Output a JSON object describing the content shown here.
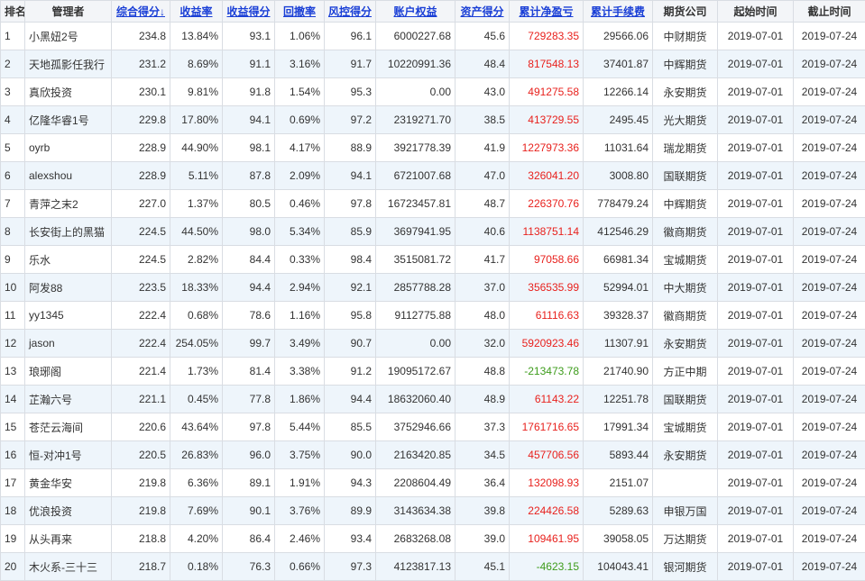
{
  "colors": {
    "positive": "#e8211d",
    "negative": "#3e9c1c",
    "sort_link": "#1a3fd6"
  },
  "headers": {
    "rank": "排名",
    "manager": "管理者",
    "total_score": "综合得分↓",
    "return_rate": "收益率",
    "return_score": "收益得分",
    "drawdown": "回撤率",
    "risk_score": "风控得分",
    "equity": "账户权益",
    "asset_score": "资产得分",
    "net_pnl": "累计净盈亏",
    "fees": "累计手续费",
    "broker": "期货公司",
    "start": "起始时间",
    "end": "截止时间"
  },
  "rows": [
    {
      "rank": "1",
      "manager": "小黑妞2号",
      "total": "234.8",
      "rate": "13.84%",
      "rscore": "93.1",
      "dd": "1.06%",
      "risk": "96.1",
      "equity": "6000227.68",
      "asset": "45.6",
      "pnl": "729283.35",
      "sign": "pos",
      "fees": "29566.06",
      "broker": "中财期货",
      "start": "2019-07-01",
      "end": "2019-07-24"
    },
    {
      "rank": "2",
      "manager": "天地孤影任我行",
      "total": "231.2",
      "rate": "8.69%",
      "rscore": "91.1",
      "dd": "3.16%",
      "risk": "91.7",
      "equity": "10220991.36",
      "asset": "48.4",
      "pnl": "817548.13",
      "sign": "pos",
      "fees": "37401.87",
      "broker": "中辉期货",
      "start": "2019-07-01",
      "end": "2019-07-24"
    },
    {
      "rank": "3",
      "manager": "真欣投资",
      "total": "230.1",
      "rate": "9.81%",
      "rscore": "91.8",
      "dd": "1.54%",
      "risk": "95.3",
      "equity": "0.00",
      "asset": "43.0",
      "pnl": "491275.58",
      "sign": "pos",
      "fees": "12266.14",
      "broker": "永安期货",
      "start": "2019-07-01",
      "end": "2019-07-24"
    },
    {
      "rank": "4",
      "manager": "亿隆华睿1号",
      "total": "229.8",
      "rate": "17.80%",
      "rscore": "94.1",
      "dd": "0.69%",
      "risk": "97.2",
      "equity": "2319271.70",
      "asset": "38.5",
      "pnl": "413729.55",
      "sign": "pos",
      "fees": "2495.45",
      "broker": "光大期货",
      "start": "2019-07-01",
      "end": "2019-07-24"
    },
    {
      "rank": "5",
      "manager": "oyrb",
      "total": "228.9",
      "rate": "44.90%",
      "rscore": "98.1",
      "dd": "4.17%",
      "risk": "88.9",
      "equity": "3921778.39",
      "asset": "41.9",
      "pnl": "1227973.36",
      "sign": "pos",
      "fees": "11031.64",
      "broker": "瑞龙期货",
      "start": "2019-07-01",
      "end": "2019-07-24"
    },
    {
      "rank": "6",
      "manager": "alexshou",
      "total": "228.9",
      "rate": "5.11%",
      "rscore": "87.8",
      "dd": "2.09%",
      "risk": "94.1",
      "equity": "6721007.68",
      "asset": "47.0",
      "pnl": "326041.20",
      "sign": "pos",
      "fees": "3008.80",
      "broker": "国联期货",
      "start": "2019-07-01",
      "end": "2019-07-24"
    },
    {
      "rank": "7",
      "manager": "青萍之末2",
      "total": "227.0",
      "rate": "1.37%",
      "rscore": "80.5",
      "dd": "0.46%",
      "risk": "97.8",
      "equity": "16723457.81",
      "asset": "48.7",
      "pnl": "226370.76",
      "sign": "pos",
      "fees": "778479.24",
      "broker": "中辉期货",
      "start": "2019-07-01",
      "end": "2019-07-24"
    },
    {
      "rank": "8",
      "manager": "长安街上的黑猫",
      "total": "224.5",
      "rate": "44.50%",
      "rscore": "98.0",
      "dd": "5.34%",
      "risk": "85.9",
      "equity": "3697941.95",
      "asset": "40.6",
      "pnl": "1138751.14",
      "sign": "pos",
      "fees": "412546.29",
      "broker": "徽商期货",
      "start": "2019-07-01",
      "end": "2019-07-24"
    },
    {
      "rank": "9",
      "manager": "乐水",
      "total": "224.5",
      "rate": "2.82%",
      "rscore": "84.4",
      "dd": "0.33%",
      "risk": "98.4",
      "equity": "3515081.72",
      "asset": "41.7",
      "pnl": "97058.66",
      "sign": "pos",
      "fees": "66981.34",
      "broker": "宝城期货",
      "start": "2019-07-01",
      "end": "2019-07-24"
    },
    {
      "rank": "10",
      "manager": "阿发88",
      "total": "223.5",
      "rate": "18.33%",
      "rscore": "94.4",
      "dd": "2.94%",
      "risk": "92.1",
      "equity": "2857788.28",
      "asset": "37.0",
      "pnl": "356535.99",
      "sign": "pos",
      "fees": "52994.01",
      "broker": "中大期货",
      "start": "2019-07-01",
      "end": "2019-07-24"
    },
    {
      "rank": "11",
      "manager": "yy1345",
      "total": "222.4",
      "rate": "0.68%",
      "rscore": "78.6",
      "dd": "1.16%",
      "risk": "95.8",
      "equity": "9112775.88",
      "asset": "48.0",
      "pnl": "61116.63",
      "sign": "pos",
      "fees": "39328.37",
      "broker": "徽商期货",
      "start": "2019-07-01",
      "end": "2019-07-24"
    },
    {
      "rank": "12",
      "manager": "jason",
      "total": "222.4",
      "rate": "254.05%",
      "rscore": "99.7",
      "dd": "3.49%",
      "risk": "90.7",
      "equity": "0.00",
      "asset": "32.0",
      "pnl": "5920923.46",
      "sign": "pos",
      "fees": "11307.91",
      "broker": "永安期货",
      "start": "2019-07-01",
      "end": "2019-07-24"
    },
    {
      "rank": "13",
      "manager": "琅琊阁",
      "total": "221.4",
      "rate": "1.73%",
      "rscore": "81.4",
      "dd": "3.38%",
      "risk": "91.2",
      "equity": "19095172.67",
      "asset": "48.8",
      "pnl": "-213473.78",
      "sign": "neg",
      "fees": "21740.90",
      "broker": "方正中期",
      "start": "2019-07-01",
      "end": "2019-07-24"
    },
    {
      "rank": "14",
      "manager": "芷瀚六号",
      "total": "221.1",
      "rate": "0.45%",
      "rscore": "77.8",
      "dd": "1.86%",
      "risk": "94.4",
      "equity": "18632060.40",
      "asset": "48.9",
      "pnl": "61143.22",
      "sign": "pos",
      "fees": "12251.78",
      "broker": "国联期货",
      "start": "2019-07-01",
      "end": "2019-07-24"
    },
    {
      "rank": "15",
      "manager": "苍茫云海间",
      "total": "220.6",
      "rate": "43.64%",
      "rscore": "97.8",
      "dd": "5.44%",
      "risk": "85.5",
      "equity": "3752946.66",
      "asset": "37.3",
      "pnl": "1761716.65",
      "sign": "pos",
      "fees": "17991.34",
      "broker": "宝城期货",
      "start": "2019-07-01",
      "end": "2019-07-24"
    },
    {
      "rank": "16",
      "manager": "恒-对冲1号",
      "total": "220.5",
      "rate": "26.83%",
      "rscore": "96.0",
      "dd": "3.75%",
      "risk": "90.0",
      "equity": "2163420.85",
      "asset": "34.5",
      "pnl": "457706.56",
      "sign": "pos",
      "fees": "5893.44",
      "broker": "永安期货",
      "start": "2019-07-01",
      "end": "2019-07-24"
    },
    {
      "rank": "17",
      "manager": "黄金华安",
      "total": "219.8",
      "rate": "6.36%",
      "rscore": "89.1",
      "dd": "1.91%",
      "risk": "94.3",
      "equity": "2208604.49",
      "asset": "36.4",
      "pnl": "132098.93",
      "sign": "pos",
      "fees": "2151.07",
      "broker": "",
      "start": "2019-07-01",
      "end": "2019-07-24"
    },
    {
      "rank": "18",
      "manager": "优浪投资",
      "total": "219.8",
      "rate": "7.69%",
      "rscore": "90.1",
      "dd": "3.76%",
      "risk": "89.9",
      "equity": "3143634.38",
      "asset": "39.8",
      "pnl": "224426.58",
      "sign": "pos",
      "fees": "5289.63",
      "broker": "申银万国",
      "start": "2019-07-01",
      "end": "2019-07-24"
    },
    {
      "rank": "19",
      "manager": "从头再来",
      "total": "218.8",
      "rate": "4.20%",
      "rscore": "86.4",
      "dd": "2.46%",
      "risk": "93.4",
      "equity": "2683268.08",
      "asset": "39.0",
      "pnl": "109461.95",
      "sign": "pos",
      "fees": "39058.05",
      "broker": "万达期货",
      "start": "2019-07-01",
      "end": "2019-07-24"
    },
    {
      "rank": "20",
      "manager": "木火系-三十三",
      "total": "218.7",
      "rate": "0.18%",
      "rscore": "76.3",
      "dd": "0.66%",
      "risk": "97.3",
      "equity": "4123817.13",
      "asset": "45.1",
      "pnl": "-4623.15",
      "sign": "neg",
      "fees": "104043.41",
      "broker": "银河期货",
      "start": "2019-07-01",
      "end": "2019-07-24"
    }
  ]
}
